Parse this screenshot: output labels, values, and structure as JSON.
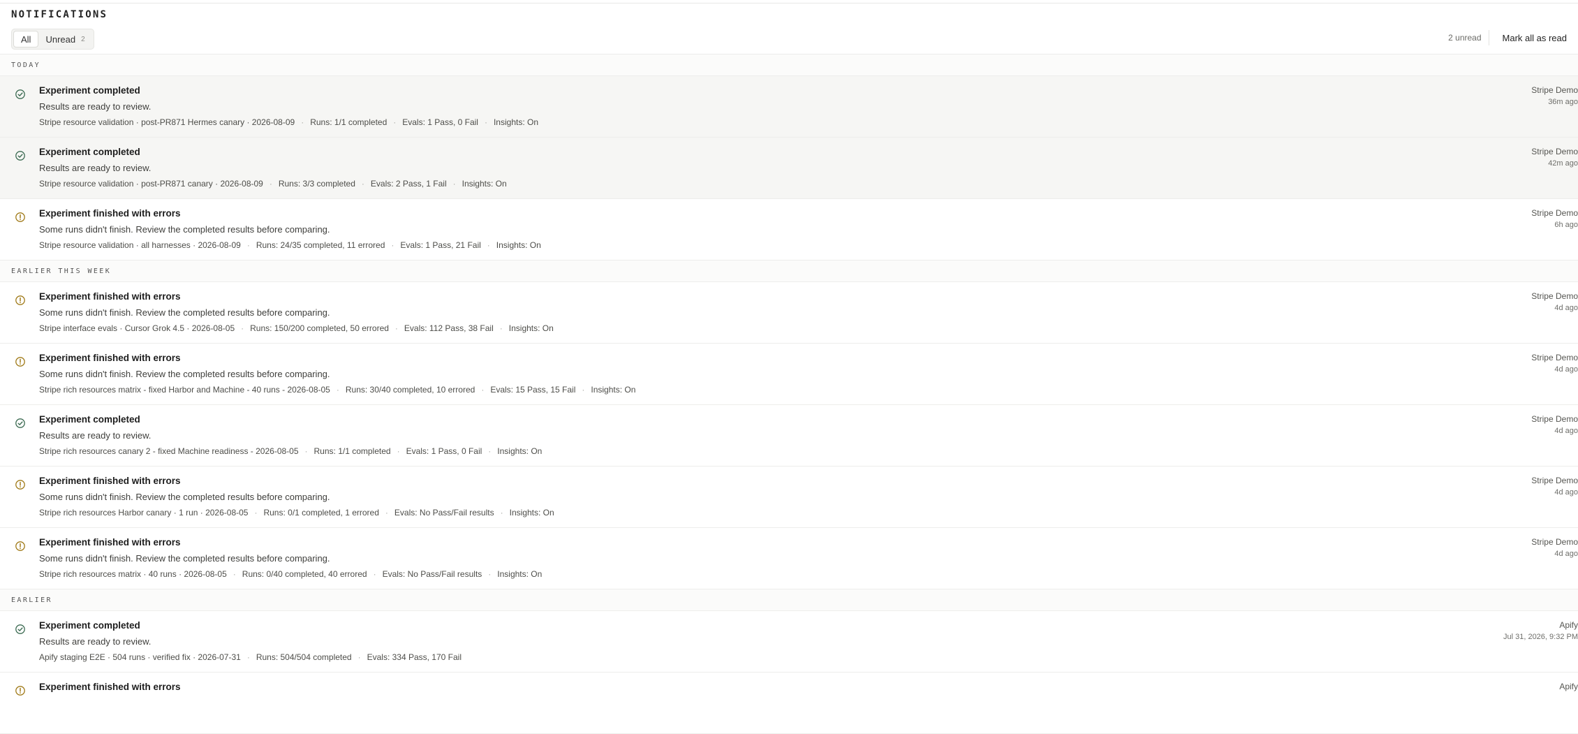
{
  "header": {
    "title": "NOTIFICATIONS",
    "tabs": [
      {
        "label": "All",
        "count": "",
        "active": true
      },
      {
        "label": "Unread",
        "count": "2",
        "active": false
      }
    ],
    "unread_count": "2 unread",
    "mark_all_label": "Mark all as read"
  },
  "colors": {
    "success": "#3c6b52",
    "warning": "#a07a18"
  },
  "sections": [
    {
      "label": "TODAY",
      "items": [
        {
          "icon": "check-circle-icon",
          "unread": true,
          "title": "Experiment completed",
          "description": "Results are ready to review.",
          "meta": [
            "Stripe resource validation · post-PR871 Hermes canary · 2026-08-09",
            "Runs: 1/1 completed",
            "Evals: 1 Pass, 0 Fail",
            "Insights: On"
          ],
          "source": "Stripe Demo",
          "time": "36m ago"
        },
        {
          "icon": "check-circle-icon",
          "unread": true,
          "title": "Experiment completed",
          "description": "Results are ready to review.",
          "meta": [
            "Stripe resource validation · post-PR871 canary · 2026-08-09",
            "Runs: 3/3 completed",
            "Evals: 2 Pass, 1 Fail",
            "Insights: On"
          ],
          "source": "Stripe Demo",
          "time": "42m ago"
        },
        {
          "icon": "warning-circle-icon",
          "unread": false,
          "title": "Experiment finished with errors",
          "description": "Some runs didn't finish. Review the completed results before comparing.",
          "meta": [
            "Stripe resource validation · all harnesses · 2026-08-09",
            "Runs: 24/35 completed, 11 errored",
            "Evals: 1 Pass, 21 Fail",
            "Insights: On"
          ],
          "source": "Stripe Demo",
          "time": "6h ago"
        }
      ]
    },
    {
      "label": "EARLIER THIS WEEK",
      "items": [
        {
          "icon": "warning-circle-icon",
          "unread": false,
          "title": "Experiment finished with errors",
          "description": "Some runs didn't finish. Review the completed results before comparing.",
          "meta": [
            "Stripe interface evals · Cursor Grok 4.5 · 2026-08-05",
            "Runs: 150/200 completed, 50 errored",
            "Evals: 112 Pass, 38 Fail",
            "Insights: On"
          ],
          "source": "Stripe Demo",
          "time": "4d ago"
        },
        {
          "icon": "warning-circle-icon",
          "unread": false,
          "title": "Experiment finished with errors",
          "description": "Some runs didn't finish. Review the completed results before comparing.",
          "meta": [
            "Stripe rich resources matrix - fixed Harbor and Machine - 40 runs - 2026-08-05",
            "Runs: 30/40 completed, 10 errored",
            "Evals: 15 Pass, 15 Fail",
            "Insights: On"
          ],
          "source": "Stripe Demo",
          "time": "4d ago"
        },
        {
          "icon": "check-circle-icon",
          "unread": false,
          "title": "Experiment completed",
          "description": "Results are ready to review.",
          "meta": [
            "Stripe rich resources canary 2 - fixed Machine readiness - 2026-08-05",
            "Runs: 1/1 completed",
            "Evals: 1 Pass, 0 Fail",
            "Insights: On"
          ],
          "source": "Stripe Demo",
          "time": "4d ago"
        },
        {
          "icon": "warning-circle-icon",
          "unread": false,
          "title": "Experiment finished with errors",
          "description": "Some runs didn't finish. Review the completed results before comparing.",
          "meta": [
            "Stripe rich resources Harbor canary · 1 run · 2026-08-05",
            "Runs: 0/1 completed, 1 errored",
            "Evals: No Pass/Fail results",
            "Insights: On"
          ],
          "source": "Stripe Demo",
          "time": "4d ago"
        },
        {
          "icon": "warning-circle-icon",
          "unread": false,
          "title": "Experiment finished with errors",
          "description": "Some runs didn't finish. Review the completed results before comparing.",
          "meta": [
            "Stripe rich resources matrix · 40 runs · 2026-08-05",
            "Runs: 0/40 completed, 40 errored",
            "Evals: No Pass/Fail results",
            "Insights: On"
          ],
          "source": "Stripe Demo",
          "time": "4d ago"
        }
      ]
    },
    {
      "label": "EARLIER",
      "items": [
        {
          "icon": "check-circle-icon",
          "unread": false,
          "title": "Experiment completed",
          "description": "Results are ready to review.",
          "meta": [
            "Apify staging E2E · 504 runs · verified fix · 2026-07-31",
            "Runs: 504/504 completed",
            "Evals: 334 Pass, 170 Fail"
          ],
          "source": "Apify",
          "time": "Jul 31, 2026, 9:32 PM"
        },
        {
          "icon": "warning-circle-icon",
          "unread": false,
          "title": "Experiment finished with errors",
          "description": "",
          "meta": [],
          "source": "Apify",
          "time": ""
        }
      ]
    }
  ]
}
